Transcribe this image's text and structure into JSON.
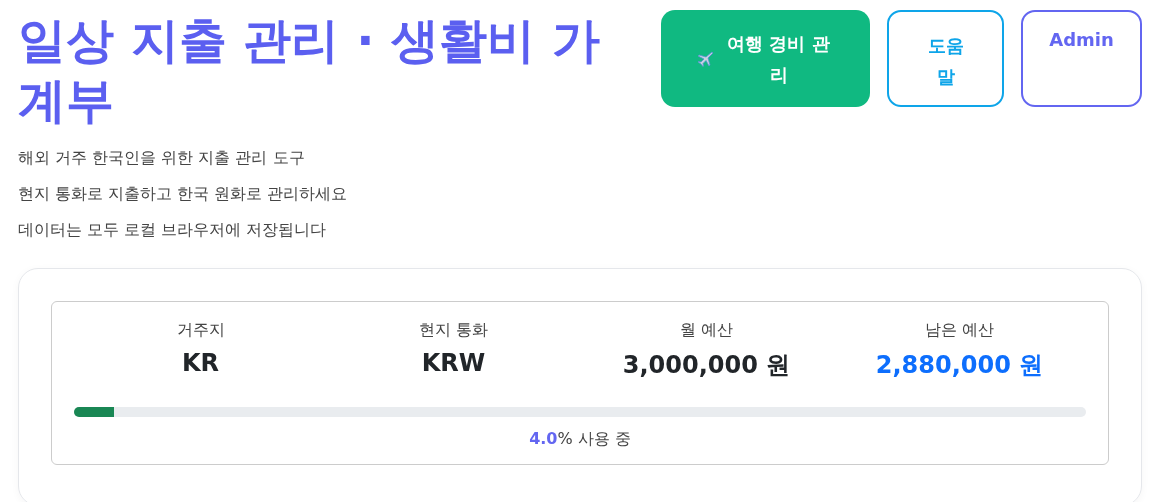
{
  "header": {
    "title": "일상 지출 관리 · 생활비 가계부",
    "buttons": [
      {
        "label": "여행 경비 관리",
        "kind": "primary"
      },
      {
        "label": "도움말",
        "kind": "outline-sky"
      },
      {
        "label": "Admin",
        "kind": "outline-violet"
      }
    ]
  },
  "intro": [
    "해외 거주 한국인을 위한 지출 관리 도구",
    "현지 통화로 지출하고 한국 원화로 관리하세요",
    "데이터는 모두 로컬 브라우저에 저장됩니다"
  ],
  "summary": {
    "stats": [
      {
        "label": "거주지",
        "value": "KR",
        "color": "#212529"
      },
      {
        "label": "현지 통화",
        "value": "KRW",
        "color": "#212529"
      },
      {
        "label": "월 예산",
        "value": "3,000,000 원",
        "color": "#212529"
      },
      {
        "label": "남은 예산",
        "value": "2,880,000 원",
        "color": "#0d6efd"
      }
    ],
    "usage": {
      "level": 0.04,
      "percent": "4.0",
      "suffix": "% 사용 중"
    }
  }
}
